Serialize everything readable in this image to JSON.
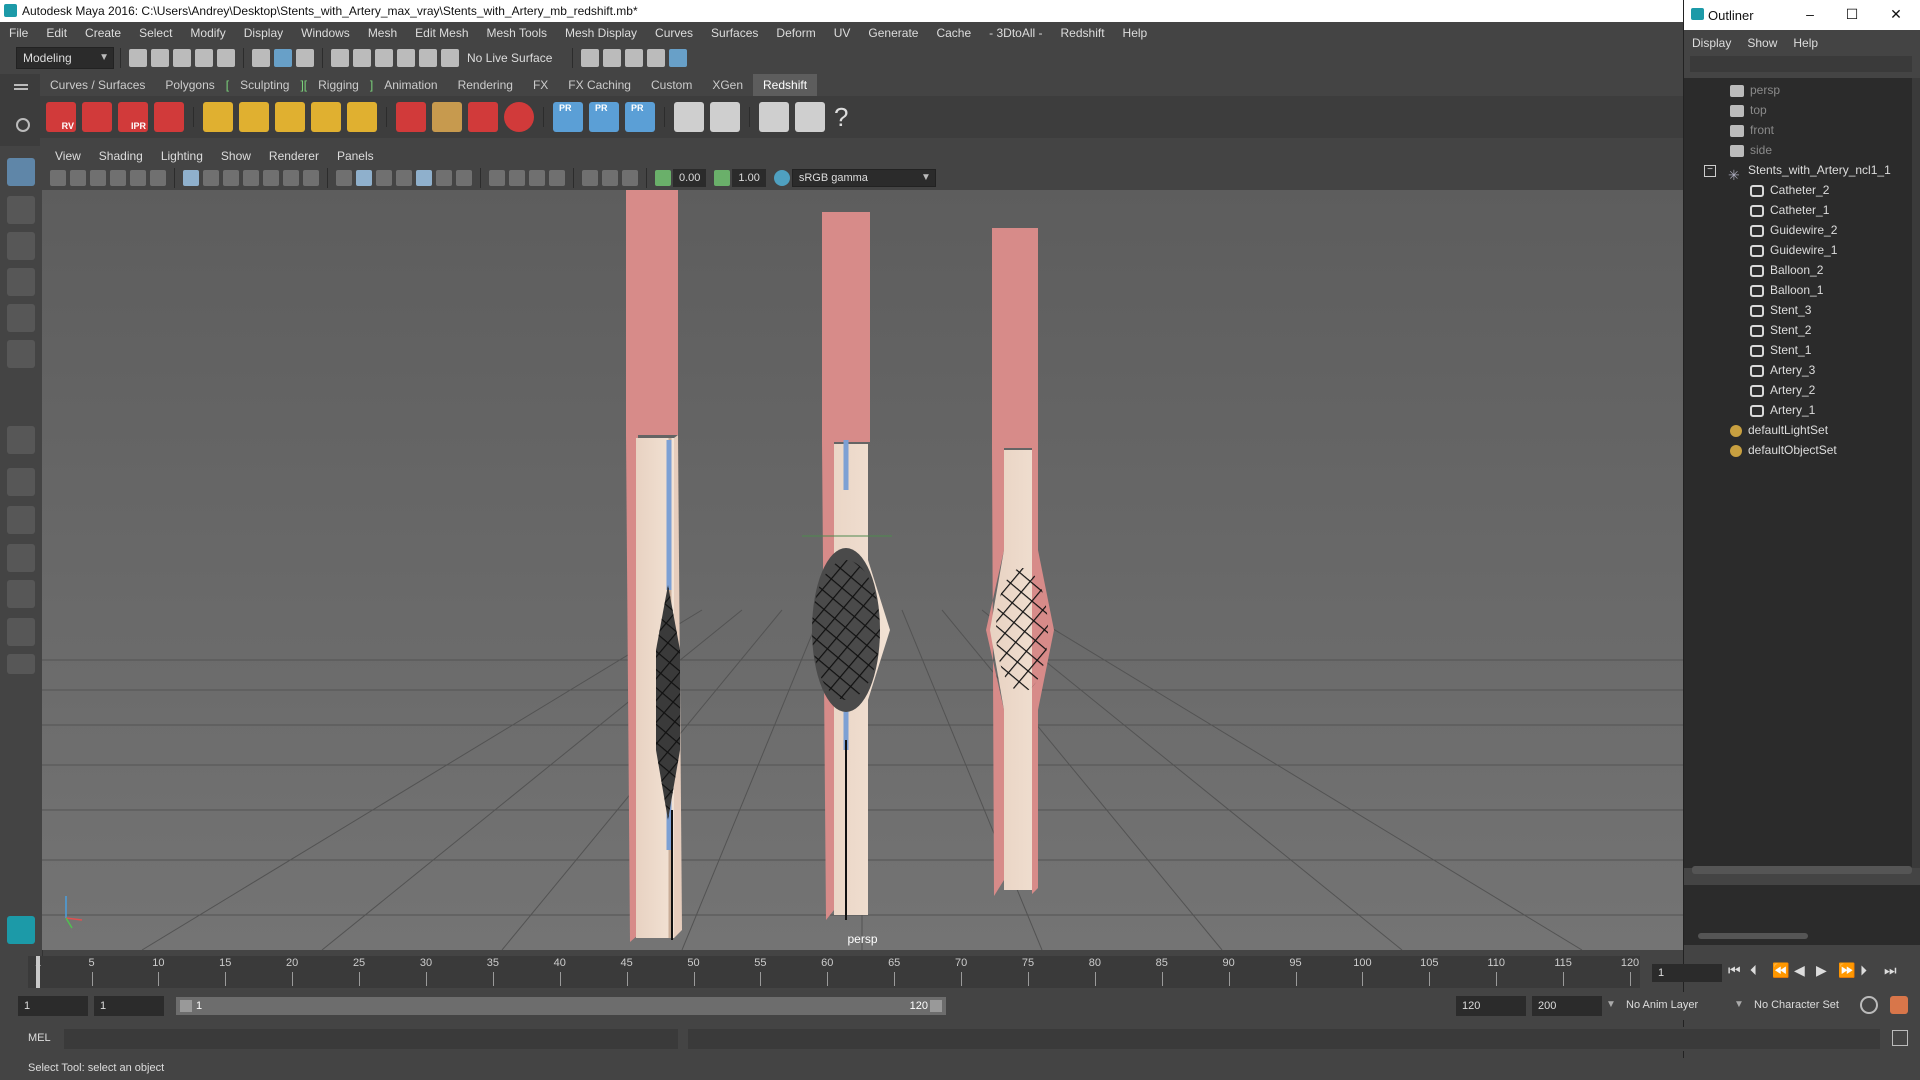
{
  "window": {
    "title": "Autodesk Maya 2016: C:\\Users\\Andrey\\Desktop\\Stents_with_Artery_max_vray\\Stents_with_Artery_mb_redshift.mb*"
  },
  "menubar": [
    "File",
    "Edit",
    "Create",
    "Select",
    "Modify",
    "Display",
    "Windows",
    "Mesh",
    "Edit Mesh",
    "Mesh Tools",
    "Mesh Display",
    "Curves",
    "Surfaces",
    "Deform",
    "UV",
    "Generate",
    "Cache",
    "- 3DtoAll -",
    "Redshift",
    "Help"
  ],
  "statusline": {
    "mode": "Modeling",
    "live_surface": "No Live Surface"
  },
  "shelf_tabs": [
    {
      "label": "Curves / Surfaces"
    },
    {
      "label": "Polygons"
    },
    {
      "label": "Sculpting"
    },
    {
      "label": "Rigging"
    },
    {
      "label": "Animation"
    },
    {
      "label": "Rendering"
    },
    {
      "label": "FX"
    },
    {
      "label": "FX Caching"
    },
    {
      "label": "Custom"
    },
    {
      "label": "XGen"
    },
    {
      "label": "Redshift"
    }
  ],
  "active_shelf_tab": "Redshift",
  "shelf_icon_labels": [
    "RV",
    "IPR",
    "PR",
    "PR",
    "PR",
    "?"
  ],
  "panel_menu": [
    "View",
    "Shading",
    "Lighting",
    "Show",
    "Renderer",
    "Panels"
  ],
  "panel_toolbar": {
    "exposure": "0.00",
    "gamma": "1.00",
    "color_space": "sRGB gamma"
  },
  "viewport": {
    "camera_label": "persp"
  },
  "outliner": {
    "title": "Outliner",
    "menu": [
      "Display",
      "Show",
      "Help"
    ],
    "items": [
      {
        "label": "persp",
        "type": "camera",
        "dim": true
      },
      {
        "label": "top",
        "type": "camera",
        "dim": true
      },
      {
        "label": "front",
        "type": "camera",
        "dim": true
      },
      {
        "label": "side",
        "type": "camera",
        "dim": true
      },
      {
        "label": "Stents_with_Artery_ncl1_1",
        "type": "group"
      },
      {
        "label": "Catheter_2",
        "type": "mesh"
      },
      {
        "label": "Catheter_1",
        "type": "mesh"
      },
      {
        "label": "Guidewire_2",
        "type": "mesh"
      },
      {
        "label": "Guidewire_1",
        "type": "mesh"
      },
      {
        "label": "Balloon_2",
        "type": "mesh"
      },
      {
        "label": "Balloon_1",
        "type": "mesh"
      },
      {
        "label": "Stent_3",
        "type": "mesh"
      },
      {
        "label": "Stent_2",
        "type": "mesh"
      },
      {
        "label": "Stent_1",
        "type": "mesh"
      },
      {
        "label": "Artery_3",
        "type": "mesh"
      },
      {
        "label": "Artery_2",
        "type": "mesh"
      },
      {
        "label": "Artery_1",
        "type": "mesh"
      },
      {
        "label": "defaultLightSet",
        "type": "set"
      },
      {
        "label": "defaultObjectSet",
        "type": "set"
      }
    ]
  },
  "timeline": {
    "ticks": [
      "1",
      "5",
      "10",
      "15",
      "20",
      "25",
      "30",
      "35",
      "40",
      "45",
      "50",
      "55",
      "60",
      "65",
      "70",
      "75",
      "80",
      "85",
      "90",
      "95",
      "100",
      "105",
      "110",
      "115",
      "120"
    ],
    "current_frame": "1"
  },
  "range": {
    "start": "1",
    "playback_start": "1",
    "slider_start": "1",
    "slider_end": "120",
    "playback_end": "120",
    "end": "200",
    "anim_layer": "No Anim Layer",
    "character_set": "No Character Set"
  },
  "command_line": {
    "label": "MEL"
  },
  "help_line": "Select Tool: select an object"
}
